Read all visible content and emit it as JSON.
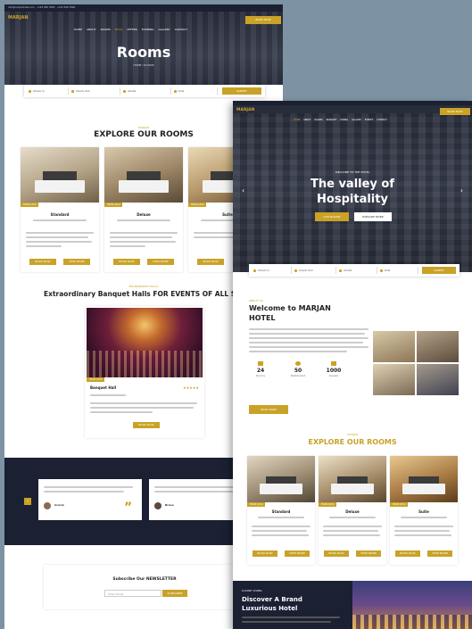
{
  "page1": {
    "topbar": {
      "email": "info@marjanhotel.com",
      "phone1": "+123 456 7890",
      "phone2": "+123 456 7890"
    },
    "logo": "MARJAN",
    "nav": [
      "HOME",
      "ABOUT",
      "ROOMS",
      "BLOG",
      "OFFERS",
      "EVENING",
      "GALLERY",
      "CONTACT"
    ],
    "nav_active": 3,
    "book_label": "BOOK NOW",
    "hero_title": "Rooms",
    "breadcrumb": "HOME / ROOMS",
    "search": {
      "checkin": "Check In",
      "checkout": "Check Out",
      "adults": "Adults",
      "kids": "Kids",
      "submit": "SUBMIT"
    },
    "rooms_kicker": "MARJAN",
    "rooms_title": "EXPLORE OUR ROOMS",
    "rooms": [
      {
        "tag": "FROM $150",
        "name": "Standard",
        "btn1": "BOOK NOW",
        "btn2": "VIEW MORE"
      },
      {
        "tag": "FROM $250",
        "name": "Deluxe",
        "btn1": "BOOK NOW",
        "btn2": "VIEW MORE"
      },
      {
        "tag": "FROM $350",
        "name": "Suite",
        "btn1": "BOOK NOW",
        "btn2": "VIEW MORE"
      }
    ],
    "halls_kicker": "ENVIRONMENT HALLS",
    "halls_title": "Extraordinary Banquet Halls FOR EVENTS OF ALL SIZES",
    "hall": {
      "tag": "FROM $500",
      "name": "Banquet Hall",
      "rating": "★★★★★",
      "btn": "BOOK NOW"
    },
    "testimonials": [
      {
        "name": "Gracia"
      },
      {
        "name": "Bravo"
      }
    ],
    "newsletter": {
      "title": "Subscribe Our NEWSLETTER",
      "placeholder": "Enter Email",
      "btn": "SUBSCRIBE"
    }
  },
  "page2": {
    "logo": "MARJAN",
    "nav": [
      "HOME",
      "ABOUT",
      "ROOMS",
      "BANQUET",
      "DINING",
      "GALLERY",
      "EVENTS",
      "CONTACT"
    ],
    "book_label": "BOOK NOW",
    "hero_kicker": "WELCOME TO THE HOTEL",
    "hero_title_line1": "The valley of",
    "hero_title_line2": "Hospitality",
    "hero_btn1": "OUR ROOMS",
    "hero_btn2": "EXPLORE MORE",
    "search": {
      "checkin": "Check In",
      "checkout": "Check Out",
      "adults": "Adults",
      "kids": "Kids",
      "submit": "SUBMIT"
    },
    "welcome_kicker": "ABOUT US",
    "welcome_title_line1": "Welcome to MARJAN",
    "welcome_title_line2": "HOTEL",
    "stats": [
      {
        "value": "24",
        "label": "Rooms"
      },
      {
        "value": "50",
        "label": "Restaurant"
      },
      {
        "value": "1000",
        "label": "Guests"
      }
    ],
    "welcome_btn": "READ MORE",
    "rooms_kicker": "MARJAN",
    "rooms_title": "EXPLORE OUR ROOMS",
    "rooms": [
      {
        "tag": "FROM $150",
        "name": "Standard",
        "btn1": "BOOK NOW",
        "btn2": "VIEW MORE"
      },
      {
        "tag": "FROM $250",
        "name": "Deluxe",
        "btn1": "BOOK NOW",
        "btn2": "VIEW MORE"
      },
      {
        "tag": "FROM $350",
        "name": "Suite",
        "btn1": "BOOK NOW",
        "btn2": "VIEW MORE"
      }
    ],
    "lux_kicker": "LUXURY LIVING",
    "lux_title_line1": "Discover A Brand",
    "lux_title_line2": "Luxurious Hotel"
  },
  "colors": {
    "accent": "#c9a227",
    "dark": "#1b2033",
    "background": "#7d93a3"
  }
}
